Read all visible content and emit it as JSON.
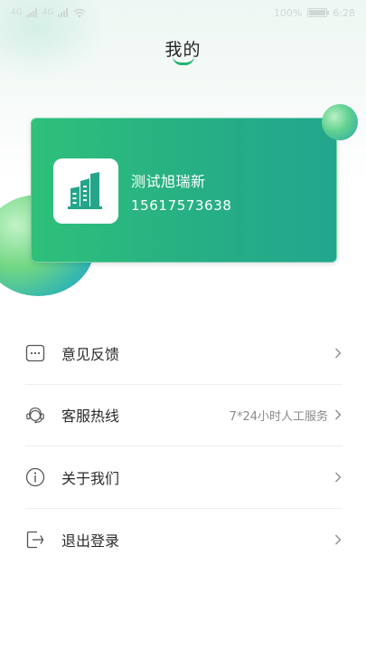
{
  "status_bar": {
    "left_signal_a": "4G",
    "left_signal_b": "4G",
    "battery_percent": "100%",
    "time": "6:28"
  },
  "header": {
    "title": "我的"
  },
  "profile": {
    "name": "测试旭瑞新",
    "phone": "15617573638",
    "avatar_icon": "building-icon"
  },
  "menu": {
    "items": [
      {
        "label": "意见反馈",
        "icon": "feedback-icon",
        "extra": ""
      },
      {
        "label": "客服热线",
        "icon": "headset-icon",
        "extra": "7*24小时人工服务"
      },
      {
        "label": "关于我们",
        "icon": "info-icon",
        "extra": ""
      },
      {
        "label": "退出登录",
        "icon": "logout-icon",
        "extra": ""
      }
    ]
  },
  "colors": {
    "accent": "#22b573",
    "card_start": "#2fc07a",
    "card_end": "#22a68e"
  }
}
